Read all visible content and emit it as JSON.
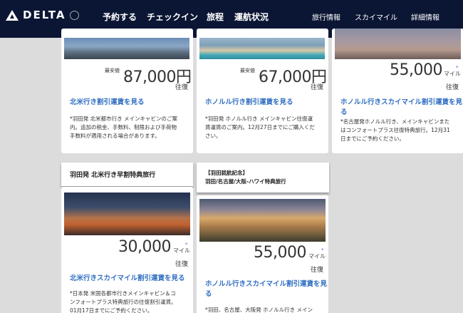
{
  "header": {
    "logo_text": "DELTA",
    "nav": [
      "予約する",
      "チェックイン",
      "旅程",
      "運航状況"
    ],
    "utility": [
      "旅行情報",
      "スカイマイル",
      "詳細情報"
    ]
  },
  "cards": [
    {
      "price_label": "最安値",
      "price": "87,000円",
      "trip": "往復",
      "link": "北米行き割引運賃を見る",
      "note": [
        "*羽田発 北米都市行き メインキャビンのご案",
        "内。追加の税金、手数料、制限および手荷物",
        "手数料が適用される場合があります。"
      ]
    },
    {
      "price_label": "最安値",
      "price": "67,000円",
      "trip": "往復",
      "link": "ホノルル行き割引運賃を見る",
      "note": [
        "*羽田発 ホノルル行き メインキャビン往復運",
        "賃運賃のご案内。12月27日までにご購入くだ",
        "さい。"
      ]
    },
    {
      "price": "55,000",
      "unit": "マイル",
      "trip": "往復",
      "link": [
        "ホノルル行きスカイマイル割引運賃を見",
        "る"
      ],
      "note": [
        "*名古屋発ホノルル行き、メインキャビンまた",
        "はコンフォートプラス往復特典旅行。12月31",
        "日までにご予約ください。"
      ]
    },
    {
      "tab": "羽田発 北米行き早割特典旅行",
      "price": "30,000",
      "unit": "マイル",
      "trip": "往復",
      "link": "北米行きスカイマイル割引運賃を見る",
      "note": [
        "*日本発 米国各都市行きメインキャビン＆コ",
        "ンフォートプラス特典旅行の往復割引運賃。",
        "01月17日までにご予約ください。"
      ]
    },
    {
      "tab": [
        "【羽田就航記念】",
        "羽田/名古屋/大阪-ハワイ特典旅行"
      ],
      "price": "55,000",
      "unit": "マイル",
      "trip": "往復",
      "link": [
        "ホノルル行きスカイマイル割引運賃を見",
        "る"
      ],
      "note": [
        "*羽田、名古屋、大阪発 ホノルル行き メイン"
      ]
    }
  ],
  "icons": {
    "star": "*"
  }
}
